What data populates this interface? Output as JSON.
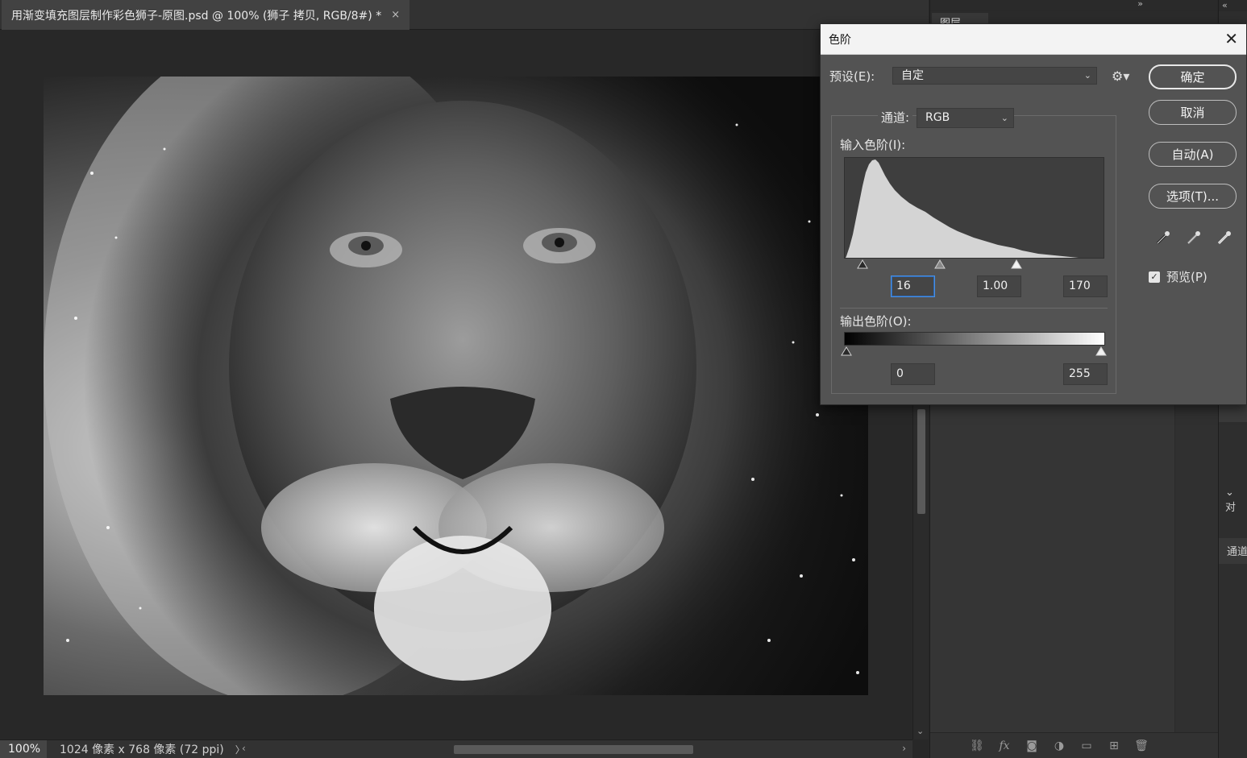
{
  "document": {
    "tab_title": "用渐变填充图层制作彩色狮子-原图.psd @ 100% (狮子 拷贝, RGB/8#) *",
    "close_glyph": "×"
  },
  "status": {
    "zoom": "100%",
    "doc_info": "1024 像素 x 768 像素 (72 ppi)",
    "arrow": "〉"
  },
  "panels": {
    "layers_tab": "图层",
    "far_item_1": "对",
    "far_item_2": "通道"
  },
  "dialog": {
    "title": "色阶",
    "close": "✕",
    "preset_label": "预设(E):",
    "preset_value": "自定",
    "channel_label": "通道:",
    "channel_value": "RGB",
    "input_label": "输入色阶(I):",
    "input_black": "16",
    "input_gamma": "1.00",
    "input_white": "170",
    "output_label": "输出色阶(O):",
    "output_black": "0",
    "output_white": "255",
    "buttons": {
      "ok": "确定",
      "cancel": "取消",
      "auto": "自动(A)",
      "options": "选项(T)..."
    },
    "preview_label": "预览(P)",
    "preview_checked": true,
    "input_levels": {
      "black": 16,
      "gamma": 1.0,
      "white": 170
    },
    "output_levels": {
      "black": 0,
      "white": 255
    }
  }
}
